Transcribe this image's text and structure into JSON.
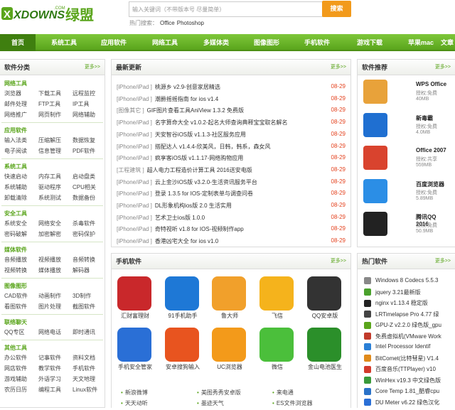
{
  "header": {
    "logo_text": "XDOWNS",
    "logo_com": ".COM",
    "logo_cn": "绿盟",
    "search_placeholder": "输入关键词（不带版本号 尽量简单）",
    "search_button": "搜索",
    "hot_label": "热门搜索：",
    "hot_items": [
      "Office",
      "Photoshop"
    ]
  },
  "nav": [
    "首页",
    "系统工具",
    "应用软件",
    "网络工具",
    "多媒体类",
    "图像图形",
    "手机软件",
    "游戏下载",
    "苹果mac",
    "文章"
  ],
  "left": {
    "title": "软件分类",
    "more": "更多>>",
    "cats": [
      {
        "name": "网络工具",
        "items": [
          "浏览器",
          "下载工具",
          "远程监控",
          "邮件处理",
          "FTP工具",
          "IP工具",
          "网络推广",
          "网页制作",
          "网络辅助"
        ]
      },
      {
        "name": "应用软件",
        "items": [
          "输入法类",
          "压缩解压",
          "数据恢复",
          "电子阅读",
          "信息管理",
          "PDF软件"
        ]
      },
      {
        "name": "系统工具",
        "items": [
          "快速启动",
          "内存工具",
          "启动盘类",
          "系统辅助",
          "驱动程序",
          "CPU相关",
          "卸载清除",
          "系统测试",
          "数据备份"
        ]
      },
      {
        "name": "安全工具",
        "items": [
          "系统安全",
          "网络安全",
          "杀毒软件",
          "密码破解",
          "加密解密",
          "密码保护"
        ]
      },
      {
        "name": "媒体软件",
        "items": [
          "音频播放",
          "视频播放",
          "音频转换",
          "视频转换",
          "媒体播放",
          "解码器"
        ]
      },
      {
        "name": "图像图形",
        "items": [
          "CAD软件",
          "动画制作",
          "3D制作",
          "看图软件",
          "图片处理",
          "截图软件"
        ]
      },
      {
        "name": "联络聊天",
        "items": [
          "QQ专区",
          "网络电话",
          "即时通讯"
        ]
      },
      {
        "name": "其他工具",
        "items": [
          "办公软件",
          "记事软件",
          "资料文档",
          "网店软件",
          "教学软件",
          "手机软件",
          "游戏辅助",
          "外语学习",
          "天文地理",
          "农历日历",
          "编程工具",
          "Linux软件"
        ]
      }
    ]
  },
  "latest": {
    "title": "最新更新",
    "more": "更多>>",
    "rows": [
      {
        "tag": "[iPhone/iPad ]",
        "t": "桃源乡 v2.9-创意家居精选",
        "d": "08-29"
      },
      {
        "tag": "[iPhone/iPad ]",
        "t": "潮爵摇摇指南 for ios v1.4",
        "d": "08-29"
      },
      {
        "tag": "[图像其它 ]",
        "t": "GIF图片查看工具AniView 1.3.2 免费版",
        "d": "08-29"
      },
      {
        "tag": "[iPhone/iPad ]",
        "t": "名字算命大全 v1.0.2-起名大师查询典释宝宝取名解名",
        "d": "08-29"
      },
      {
        "tag": "[iPhone/iPad ]",
        "t": "天安智谷iOS版 v1.1.3-社区服务应用",
        "d": "08-29"
      },
      {
        "tag": "[iPhone/iPad ]",
        "t": "搭配达人 v1.4.4-欣美风，日韩，韩系，森女风",
        "d": "08-29"
      },
      {
        "tag": "[iPhone/iPad ]",
        "t": "疯享客iOS版 v1.1.17-网络购物应用",
        "d": "08-29"
      },
      {
        "tag": "[工程建筑 ]",
        "t": "超人电力工程造价计算工具 2016送安电版",
        "d": "08-29"
      },
      {
        "tag": "[iPhone/iPad ]",
        "t": "云上金沙iOS版 v3.2.0-生活资讯服务平台",
        "d": "08-29"
      },
      {
        "tag": "[iPhone/iPad ]",
        "t": "登录 1.3.5 for IOS-定制表单与调查问卷",
        "d": "08-29"
      },
      {
        "tag": "[iPhone/iPad ]",
        "t": "DL形象机构ios版 2.0 生活实用",
        "d": "08-29"
      },
      {
        "tag": "[iPhone/iPad ]",
        "t": "艺术卫士ios版 1.0.0",
        "d": "08-29"
      },
      {
        "tag": "[iPhone/iPad ]",
        "t": "奇特视听 v1.8 for IOS-视频制作app",
        "d": "08-29"
      },
      {
        "tag": "[iPhone/iPad ]",
        "t": "香港凶宅大全 for ios v1.0",
        "d": "08-29"
      }
    ]
  },
  "rec": {
    "title": "软件推荐",
    "more": "更多>>",
    "items": [
      {
        "name": "WPS Office",
        "license": "授权:免费",
        "size": "40MB",
        "color": "#e8a23a"
      },
      {
        "name": "新毒霸",
        "license": "授权:免费",
        "size": "4.0MB",
        "color": "#1f6fd1"
      },
      {
        "name": "Office 2007",
        "license": "授权:共享",
        "size": "559MB",
        "color": "#d9432e"
      },
      {
        "name": "百度浏览器",
        "license": "授权:免费",
        "size": "5.89MB",
        "color": "#2b8ee6"
      },
      {
        "name": "腾讯QQ 2016",
        "license": "授权:免费",
        "size": "50.9MB",
        "color": "#222222"
      }
    ]
  },
  "mobile": {
    "title": "手机软件",
    "more": "更多>>",
    "apps": [
      "汇财富理财",
      "91手机助手",
      "鲁大师",
      "飞信",
      "QQ安卓版",
      "手机安全管家",
      "安卓搜狗输入",
      "UC浏览器",
      "微信",
      "金山电池医生"
    ],
    "app_colors": [
      "#c9282b",
      "#1e78d6",
      "#f1a02b",
      "#f5b31c",
      "#333333",
      "#2a6fd6",
      "#e8541f",
      "#f39a1a",
      "#4bbf3b",
      "#2b8f2a"
    ],
    "bottom": [
      "新浪微博",
      "美图秀秀安卓版",
      "来电通",
      "天天动听",
      "墨迹天气",
      "ES文件浏览器"
    ]
  },
  "hotlist": {
    "title": "热门软件",
    "more": "更多>>",
    "items": [
      "Windows 8 Codecs 5.5.3",
      "jquery 3.21最新版",
      "nginx v1.13.4 稳定版",
      "LRTimelapse Pro 4.77 绿",
      "GPU-Z v2.2.0 绿色版_gpu",
      "免费虚拟机(VMware Work",
      "Intel Processor Identif",
      "BitComet(比特彗星) V1.4",
      "百度音乐(TTPlayer) v10",
      "WinHex v19.3 中文绿色版",
      "Core Temp 1.81_酷睿cpu",
      "DU Meter v6.22 绿色汉化"
    ],
    "colors": [
      "#888888",
      "#4aa12c",
      "#222222",
      "#444444",
      "#5aa51c",
      "#c23b2b",
      "#2a7fd6",
      "#e08a1b",
      "#d33a2c",
      "#3a9a3a",
      "#2a72c8",
      "#2a6fd6"
    ]
  }
}
